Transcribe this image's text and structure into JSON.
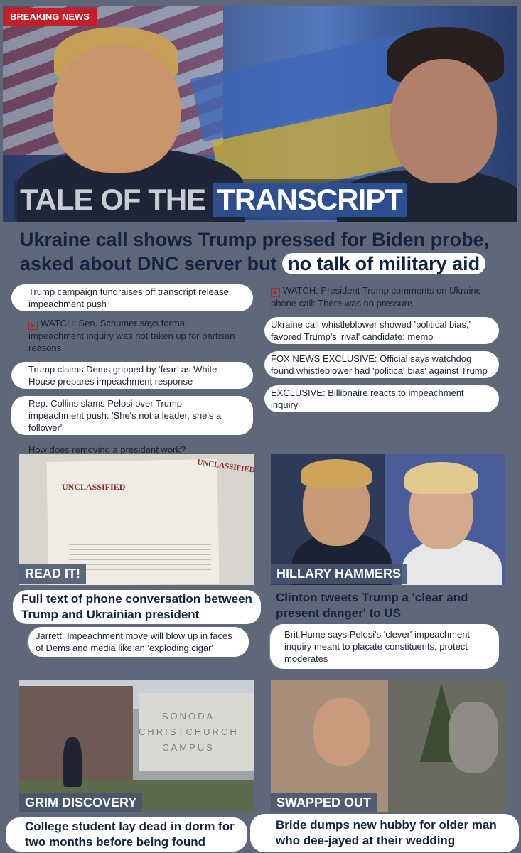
{
  "hero": {
    "badge": "BREAKING NEWS",
    "tale_part1": "TALE OF THE",
    "tale_part2": "TRANSCRIPT"
  },
  "headline": {
    "line_part1": "Ukraine call shows Trump pressed for Biden probe, asked about DNC server but",
    "line_part2": "no talk of military aid"
  },
  "left_links": [
    {
      "text": "Trump campaign fundraises off transcript release, impeachment push",
      "video": false
    },
    {
      "text": "WATCH: Sen. Schumer says formal impeachment inquiry was not taken up for partisan reasons",
      "video": true
    },
    {
      "text": "Trump claims Dems gripped by ‘fear’ as White House prepares impeachment response",
      "video": false
    },
    {
      "text": "Rep. Collins slams Pelosi over Trump impeachment push: 'She's not a leader, she's a follower'",
      "video": false
    },
    {
      "text": "How does removing a president work?",
      "video": false
    }
  ],
  "right_links": [
    {
      "text": "WATCH: President Trump comments on Ukraine phone call: There was no pressure",
      "video": true
    },
    {
      "text": "Ukraine call whistleblower showed 'political bias,' favored Trump's 'rival' candidate: memo",
      "video": false
    },
    {
      "text": "FOX NEWS EXCLUSIVE: Official says watchdog found whistleblower had 'political bias' against Trump",
      "video": false
    },
    {
      "text": "EXCLUSIVE: Billionaire reacts to impeachment inquiry",
      "video": false
    }
  ],
  "cards": [
    {
      "label": "READ IT!",
      "title": "Full text of phone conversation between Trump and Ukrainian president",
      "sub": "Jarrett: Impeachment move will blow up in faces of Dems and media like an 'exploding cigar'"
    },
    {
      "label": "HILLARY HAMMERS",
      "title": "Clinton tweets Trump a 'clear and present danger' to US",
      "sub": "Brit Hume says Pelosi's 'clever' impeachment inquiry meant to placate constituents, protect moderates"
    },
    {
      "label": "GRIM DISCOVERY",
      "title": "College student lay dead in dorm for two months before being found",
      "sub": ""
    },
    {
      "label": "SWAPPED OUT",
      "title": "Bride dumps new hubby for older man who dee-jayed at their wedding",
      "sub": ""
    }
  ],
  "document_image": {
    "stamp": "UNCLASSIFIED"
  },
  "campus_sign": {
    "line1": "SONODA",
    "line2": "CHRISTCHURCH",
    "line3": "CAMPUS"
  },
  "icons": {
    "video": "play-icon"
  },
  "colors": {
    "badge": "#c41e2a",
    "headline": "#13233f",
    "background": "#5f6878"
  }
}
